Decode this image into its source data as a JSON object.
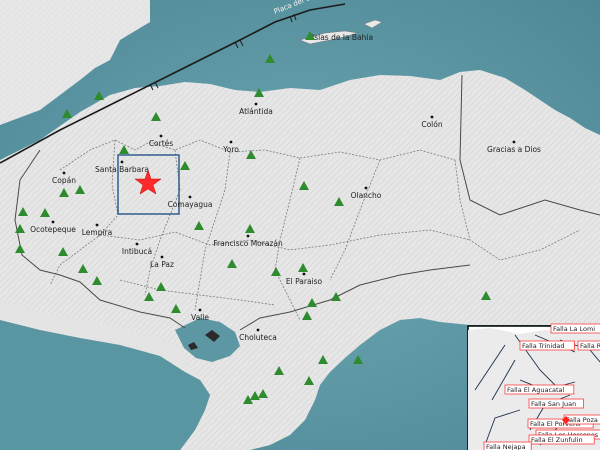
{
  "map": {
    "plate_label": "Placa del Caribe (CA)",
    "colors": {
      "sea": "#5f9aa7",
      "land": "#e6e6e6",
      "border": "#707070",
      "station": "#2e8b2e",
      "epicenter": "#ff2b2b",
      "study_box": "#2f5e8e",
      "fault_label_box": "#ff3b3b"
    },
    "cities": [
      {
        "name": "Islas de la Bahia"
      },
      {
        "name": "Atlántida"
      },
      {
        "name": "Colón"
      },
      {
        "name": "Cortés"
      },
      {
        "name": "Yoro"
      },
      {
        "name": "Gracias a Dios"
      },
      {
        "name": "Santa Barbara"
      },
      {
        "name": "Copán"
      },
      {
        "name": "Comayagua"
      },
      {
        "name": "Olancho"
      },
      {
        "name": "Ocotepeque"
      },
      {
        "name": "Lempira"
      },
      {
        "name": "Francisco Morazán"
      },
      {
        "name": "Intibucá"
      },
      {
        "name": "La Paz"
      },
      {
        "name": "El Paraiso"
      },
      {
        "name": "Valle"
      },
      {
        "name": "Choluteca"
      }
    ],
    "station_icon": "triangle-station-icon",
    "epicenter_icon": "star-epicenter-icon"
  },
  "inset": {
    "faults": [
      {
        "name": "Falla La Lomi"
      },
      {
        "name": "Falla Trinidad"
      },
      {
        "name": "Falla R"
      },
      {
        "name": "Falla El Aguacatal"
      },
      {
        "name": "Falla San Juan"
      },
      {
        "name": "Falla El Porvenir"
      },
      {
        "name": "Falla Poza Azul"
      },
      {
        "name": "Falla Los Horcones"
      },
      {
        "name": "Falla El Zunfulin"
      },
      {
        "name": "Falla Nejapa"
      }
    ]
  }
}
